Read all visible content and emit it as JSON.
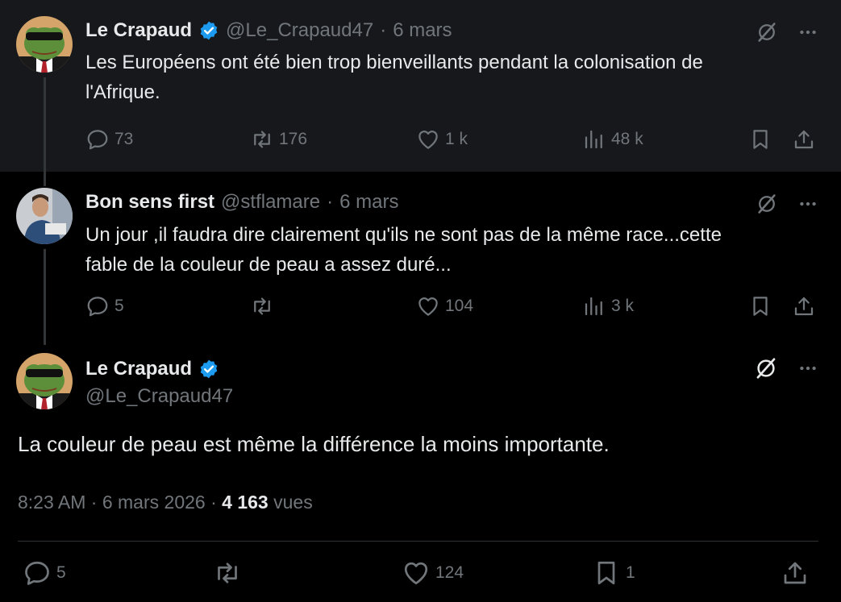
{
  "tweets": [
    {
      "name": "Le Crapaud",
      "handle": "@Le_Crapaud47",
      "dot": "·",
      "date": "6 mars",
      "text_line1": "Les Européens ont été bien trop bienveillants pendant la colonisation de",
      "text_line2": "l'Afrique.",
      "replies": "73",
      "reposts": "176",
      "likes": "1 k",
      "views": "48 k"
    },
    {
      "name": "Bon sens first",
      "handle": "@stflamare",
      "dot": "·",
      "date": "6 mars",
      "text_line1": "Un jour ,il faudra dire clairement qu'ils ne sont pas de la même race...cette",
      "text_line2": "fable de la couleur de peau a assez duré...",
      "replies": "5",
      "reposts": "",
      "likes": "104",
      "views": "3 k"
    }
  ],
  "main": {
    "name": "Le Crapaud",
    "handle": "@Le_Crapaud47",
    "text": "La couleur de peau est même la différence la moins importante.",
    "time": "8:23 AM",
    "sep1": "·",
    "date": "6 mars 2026",
    "sep2": "·",
    "views_count": "4 163",
    "views_label": "vues",
    "replies": "5",
    "likes": "124",
    "bookmarks": "1"
  },
  "colors": {
    "background": "#000000",
    "highlight_bg": "#16181c",
    "text": "#e7e9ea",
    "muted": "#71767b",
    "verified": "#1d9bf0"
  },
  "icons": [
    "verified-badge-icon",
    "grok-icon",
    "more-icon",
    "reply-icon",
    "repost-icon",
    "like-icon",
    "views-icon",
    "bookmark-icon",
    "share-icon"
  ]
}
